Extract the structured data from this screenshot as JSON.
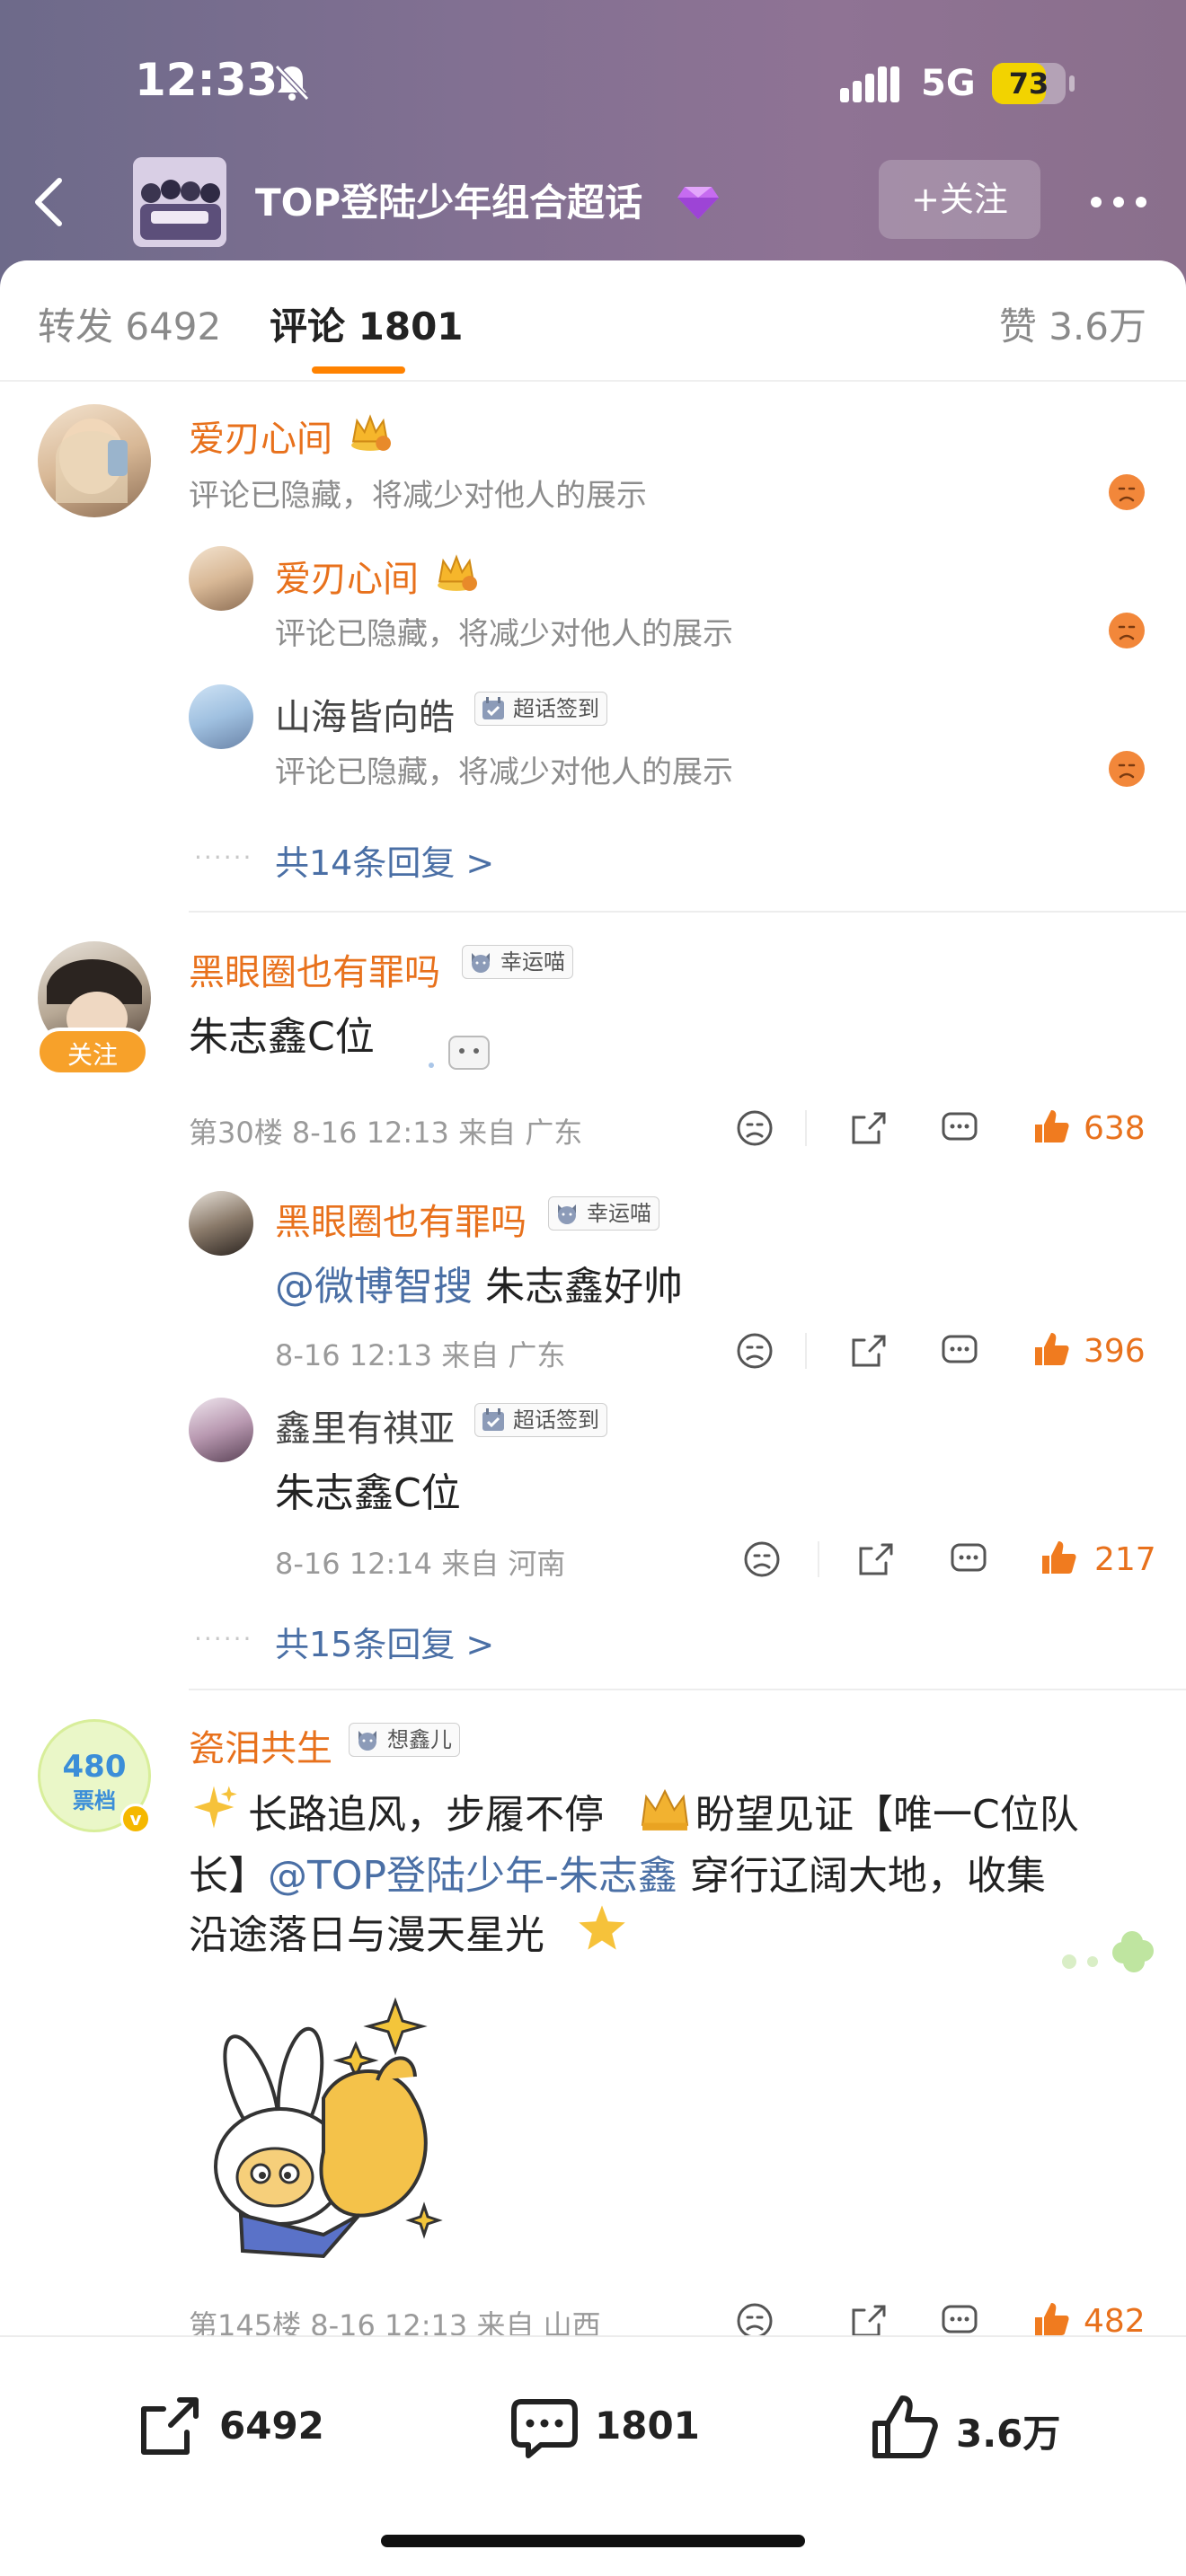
{
  "status": {
    "time": "12:33",
    "network": "5G",
    "battery": "73",
    "battery_level": 0.73
  },
  "header": {
    "title": "TOP登陆少年组合超话",
    "follow_label": "+关注"
  },
  "tabs": {
    "repost": "转发 6492",
    "comment": "评论 1801",
    "like": "赞 3.6万"
  },
  "comments": [
    {
      "name": "爱刃心间",
      "text": "评论已隐藏，将减少对他人的展示",
      "replies": [
        {
          "name": "爱刃心间",
          "text": "评论已隐藏，将减少对他人的展示"
        },
        {
          "name": "山海皆向皓",
          "badge": "超话签到",
          "text": "评论已隐藏，将减少对他人的展示"
        }
      ],
      "more_replies": "共14条回复 >"
    },
    {
      "name": "黑眼圈也有罪吗",
      "badge": "幸运喵",
      "follow_tag": "关注",
      "text": "朱志鑫C位",
      "meta": "第30楼 8-16 12:13 来自 广东",
      "likes": "638",
      "replies": [
        {
          "name": "黑眼圈也有罪吗",
          "badge": "幸运喵",
          "mention": "@微博智搜",
          "text": " 朱志鑫好帅",
          "meta": "8-16 12:13 来自 广东",
          "likes": "396"
        },
        {
          "name": "鑫里有祺亚",
          "badge": "超话签到",
          "text": "朱志鑫C位",
          "meta": "8-16 12:14 来自 河南",
          "likes": "217"
        }
      ],
      "more_replies": "共15条回复 >"
    },
    {
      "name": "瓷泪共生",
      "badge": "想鑫儿",
      "avatar_text_top": "480",
      "avatar_text_bottom": "票档",
      "line1": "长路追风，步履不停",
      "line1b": "盼望见证【唯一C位队",
      "line2a": "长】",
      "line2_mention": "@TOP登陆少年-朱志鑫",
      "line2b": " 穿行辽阔大地，收集",
      "line3": "沿途落日与漫天星光",
      "meta": "第145楼 8-16 12:13 来自 山西",
      "likes": "482"
    }
  ],
  "bottom_bar": {
    "repost": "6492",
    "comment": "1801",
    "like": "3.6万"
  }
}
